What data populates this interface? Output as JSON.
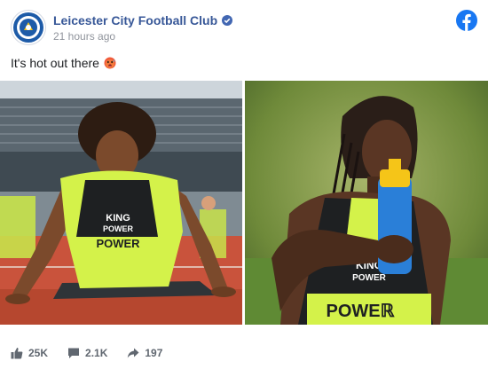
{
  "post": {
    "page_name": "Leicester City Football Club",
    "timestamp": "21 hours ago",
    "caption": "It's hot out there",
    "caption_emoji": "hot-face-emoji",
    "brand_color": "#385898",
    "facebook_blue": "#1877f2"
  },
  "photos": {
    "left": {
      "shirt_text_top": "KING",
      "shirt_text_mid": "POWER",
      "shirt_text_bottom": "POWER"
    },
    "right": {
      "shirt_text_mid": "KING",
      "shirt_text_low": "POWER",
      "shirt_text_bottom": "POWEℝ"
    }
  },
  "stats": {
    "reactions": "25K",
    "comments": "2.1K",
    "shares": "197",
    "reactions_icon": "thumbs-up-icon",
    "comments_icon": "comment-icon",
    "shares_icon": "share-icon"
  }
}
